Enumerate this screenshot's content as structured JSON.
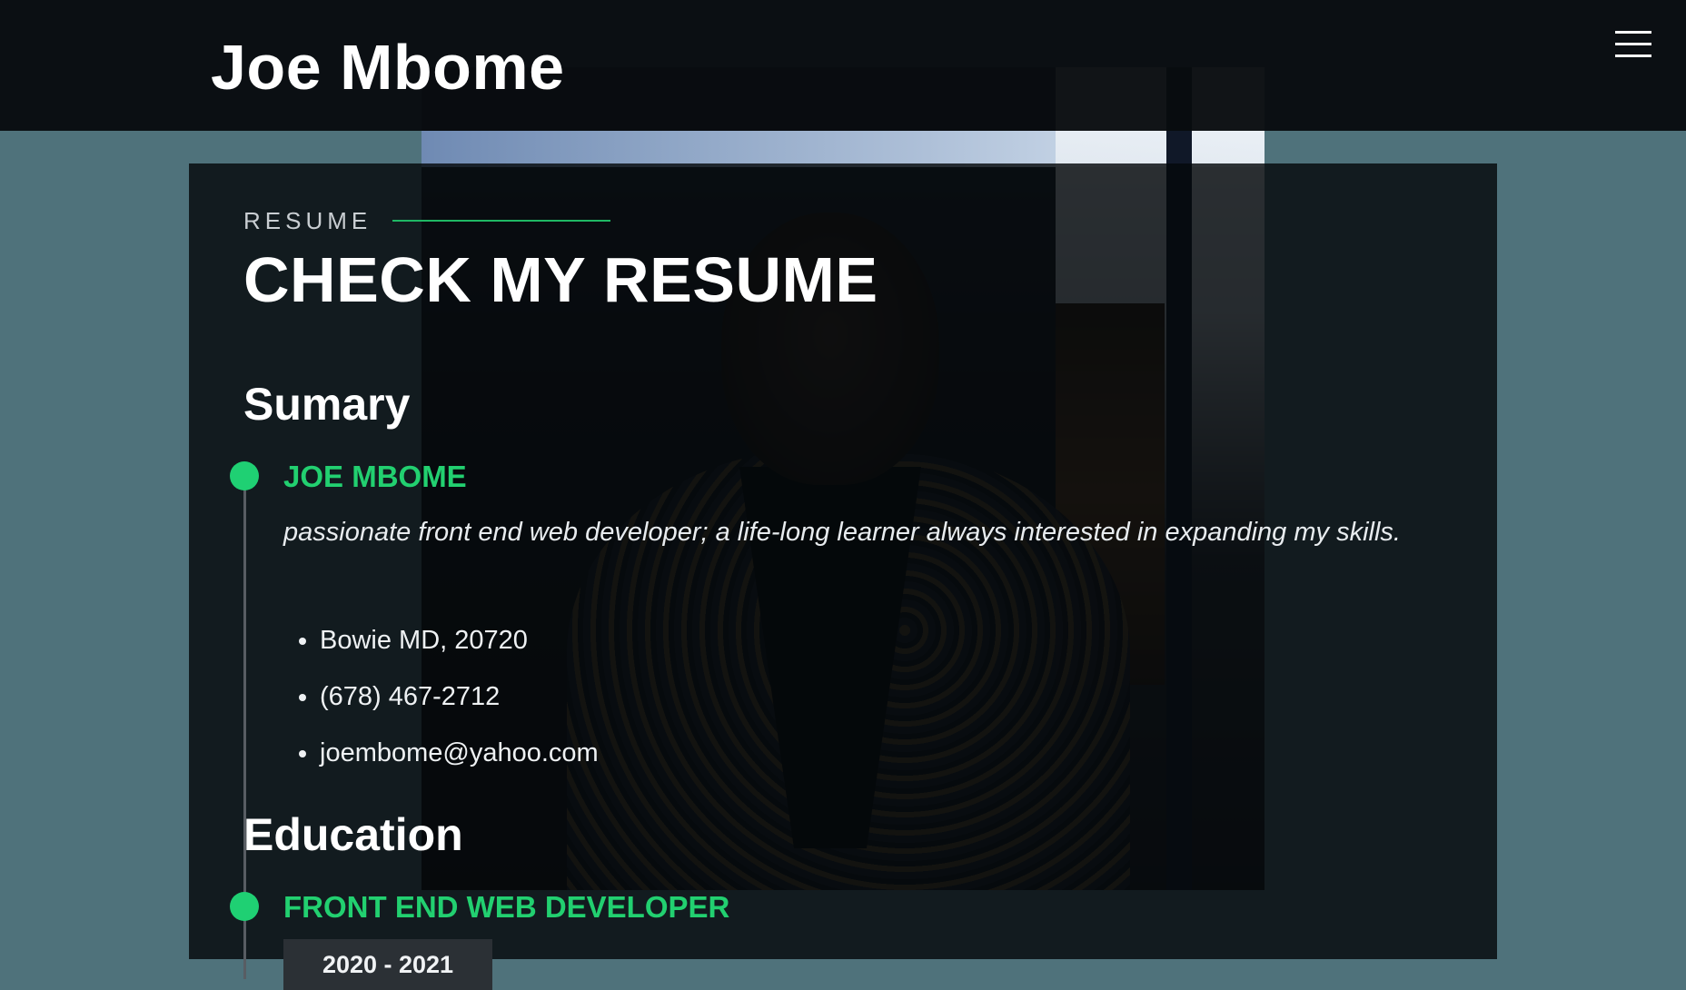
{
  "header": {
    "site_title": "Joe Mbome",
    "menu_icon": "hamburger-menu-icon"
  },
  "resume": {
    "section_label": "RESUME",
    "section_title": "CHECK MY RESUME",
    "accent_color": "#22d070",
    "summary": {
      "heading": "Sumary",
      "name": "JOE MBOME",
      "description": "passionate front end web developer; a life-long learner always interested in expanding my skills.",
      "contact": [
        "Bowie MD, 20720",
        "(678) 467-2712",
        "joembome@yahoo.com"
      ]
    },
    "education": {
      "heading": "Education",
      "title": "FRONT END WEB DEVELOPER",
      "dates": "2020 - 2021"
    }
  }
}
